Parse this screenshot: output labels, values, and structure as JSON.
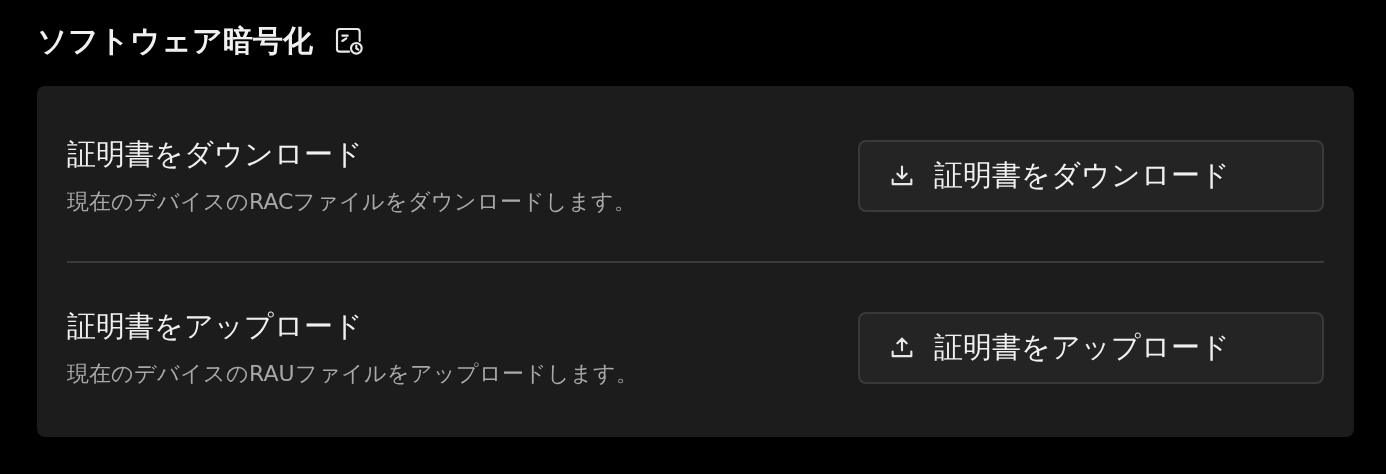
{
  "section": {
    "title": "ソフトウェア暗号化"
  },
  "rows": [
    {
      "title": "証明書をダウンロード",
      "description": "現在のデバイスのRACファイルをダウンロードします。",
      "button": {
        "label": "証明書をダウンロード",
        "kind": "download"
      }
    },
    {
      "title": "証明書をアップロード",
      "description": "現在のデバイスのRAUファイルをアップロードします。",
      "button": {
        "label": "証明書をアップロード",
        "kind": "upload"
      }
    }
  ]
}
